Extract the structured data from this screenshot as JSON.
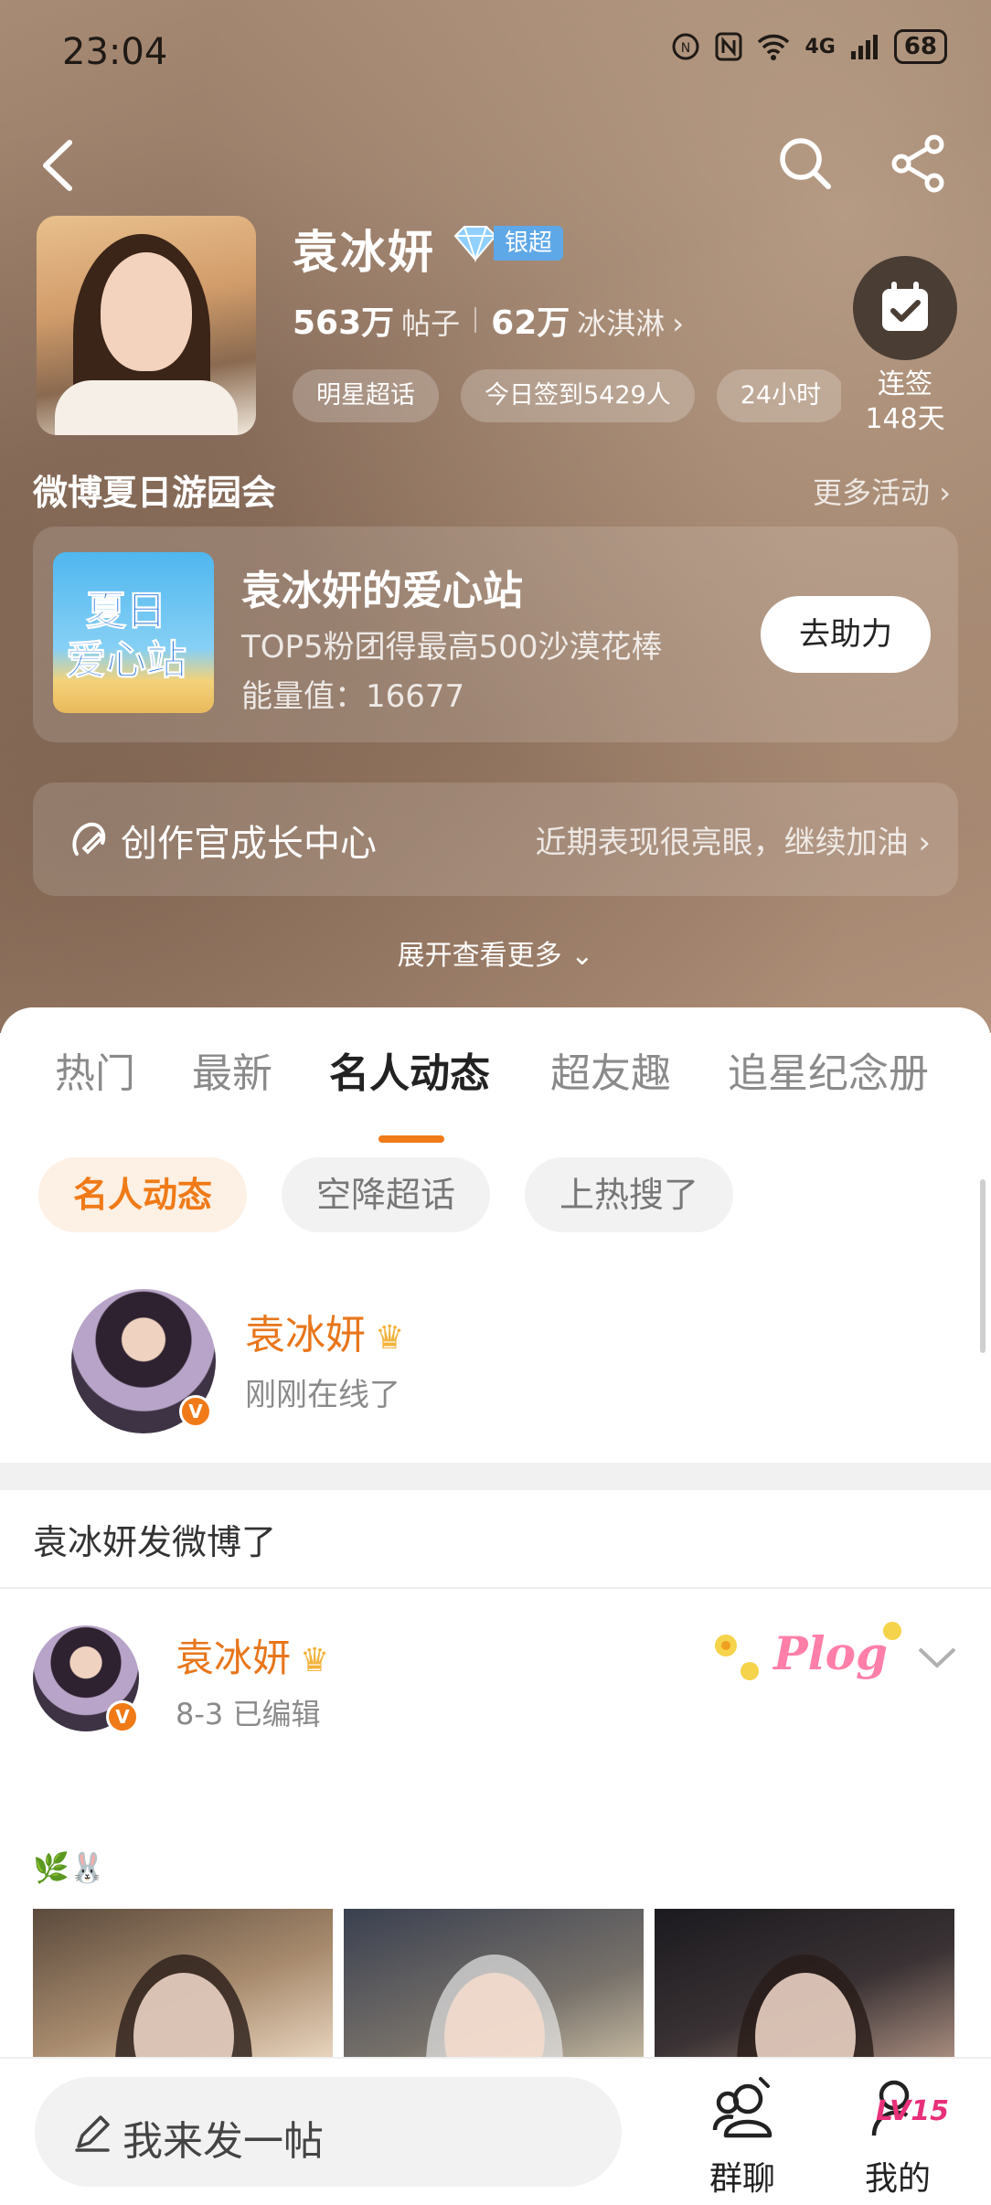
{
  "status_bar": {
    "time": "23:04",
    "network": "4G",
    "battery": "68",
    "icons": [
      "nfc-icon",
      "n-icon",
      "wifi-icon",
      "signal-icon",
      "battery-icon"
    ]
  },
  "nav": {
    "icons": [
      "back-icon",
      "search-icon",
      "share-icon"
    ]
  },
  "topic": {
    "name": "袁冰妍",
    "level": "银超",
    "posts_count": "563万",
    "posts_unit": "帖子",
    "fans_count": "62万",
    "fans_unit": "冰淇淋",
    "tags": [
      "明星超话",
      "今日签到5429人",
      "24小时"
    ],
    "checkin_label": "连签",
    "checkin_days": "148天"
  },
  "activity": {
    "title": "微博夏日游园会",
    "more": "更多活动",
    "card": {
      "thumb_line1": "夏日",
      "thumb_line2": "爱心站",
      "name": "袁冰妍的爱心站",
      "desc": "TOP5粉团得最高500沙漠花棒",
      "energy": "能量值：16677",
      "button": "去助力"
    }
  },
  "growth": {
    "title": "创作官成长中心",
    "subtitle": "近期表现很亮眼，继续加油"
  },
  "expand_label": "展开查看更多",
  "tabs": [
    "热门",
    "最新",
    "名人动态",
    "超友趣",
    "追星纪念册"
  ],
  "active_tab": "名人动态",
  "chips": [
    "名人动态",
    "空降超话",
    "上热搜了"
  ],
  "celebrity": {
    "name": "袁冰妍",
    "status": "刚刚在线了",
    "verified": "V"
  },
  "section_label": "袁冰妍发微博了",
  "post": {
    "author": "袁冰妍",
    "meta": "8-3  已编辑",
    "sticker_text": "Plog",
    "emoji": "🌿🐰",
    "photos": 3
  },
  "bottom": {
    "compose_placeholder": "我来发一帖",
    "group_chat": "群聊",
    "me": "我的",
    "level": "LV15"
  },
  "colors": {
    "accent": "#f07a18",
    "name_orange": "#e8761b",
    "level_blue": "#5fa8e8",
    "level_pink": "#e8317a"
  }
}
